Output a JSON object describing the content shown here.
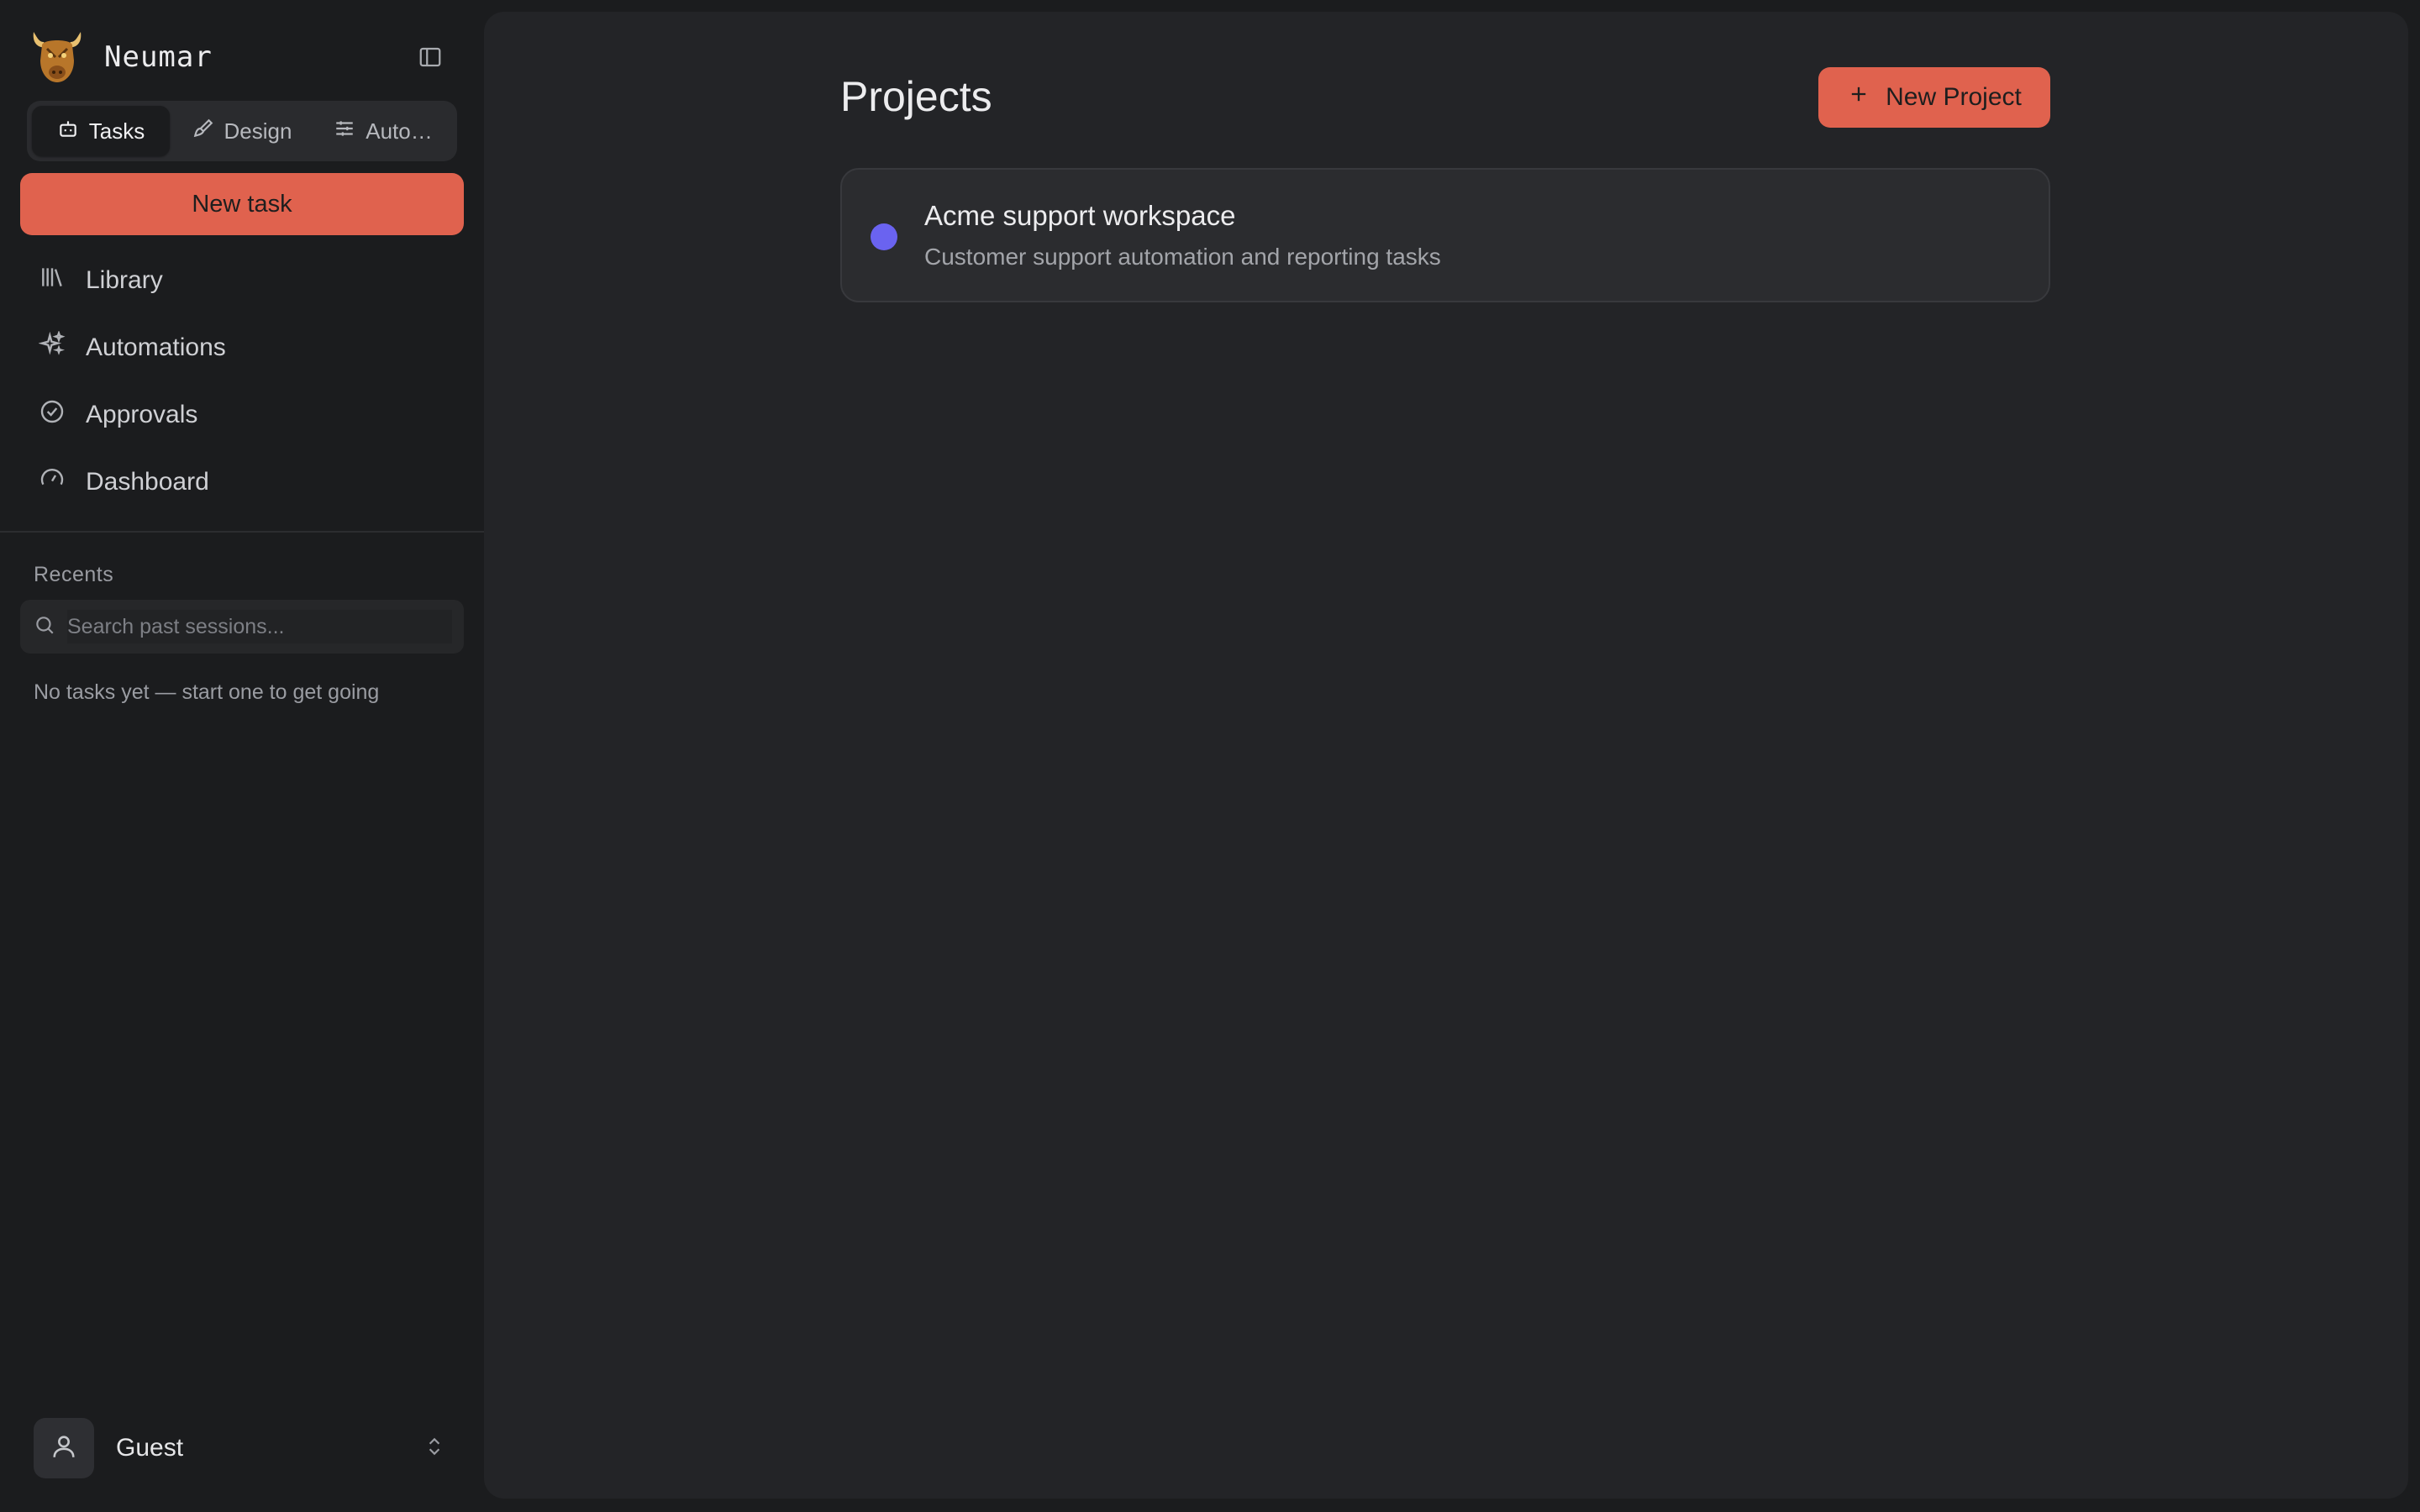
{
  "app": {
    "name": "Neumar"
  },
  "sidebar": {
    "mode_tabs": [
      {
        "label": "Tasks",
        "icon": "bot-icon",
        "active": true
      },
      {
        "label": "Design",
        "icon": "brush-icon",
        "active": false
      },
      {
        "label": "Auto…",
        "icon": "sliders-icon",
        "active": false
      }
    ],
    "new_task_label": "New task",
    "nav": [
      {
        "label": "Library",
        "icon": "library-icon"
      },
      {
        "label": "Automations",
        "icon": "sparkles-icon"
      },
      {
        "label": "Approvals",
        "icon": "check-circle-icon"
      },
      {
        "label": "Dashboard",
        "icon": "gauge-icon"
      }
    ],
    "recents": {
      "title": "Recents",
      "search_placeholder": "Search past sessions...",
      "empty_text": "No tasks yet — start one to get going"
    },
    "user": {
      "name": "Guest"
    }
  },
  "main": {
    "title": "Projects",
    "new_project_label": "New Project",
    "projects": [
      {
        "name": "Acme support workspace",
        "description": "Customer support automation and reporting tasks",
        "color": "#6a63f0"
      }
    ]
  },
  "colors": {
    "accent": "#e0624e",
    "project_dot": "#6a63f0"
  }
}
